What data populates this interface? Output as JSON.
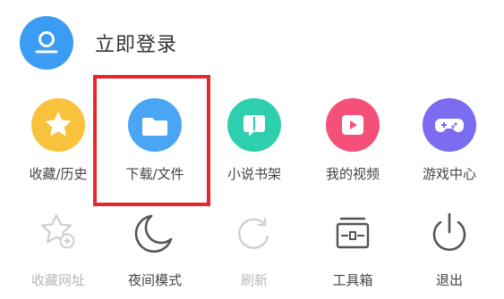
{
  "login": {
    "label": "立即登录",
    "avatar_icon": "user-avatar-icon",
    "avatar_color": "#3a9cf2"
  },
  "menu": {
    "row1": [
      {
        "label": "收藏/历史",
        "icon": "star-icon",
        "color": "#f9c23c"
      },
      {
        "label": "下载/文件",
        "icon": "folder-icon",
        "color": "#4aa6f5"
      },
      {
        "label": "小说书架",
        "icon": "book-icon",
        "color": "#2ecfae"
      },
      {
        "label": "我的视频",
        "icon": "play-icon",
        "color": "#f5507a"
      },
      {
        "label": "游戏中心",
        "icon": "gamepad-icon",
        "color": "#7b6cf0"
      }
    ],
    "row2": [
      {
        "label": "收藏网址",
        "icon": "star-add-icon",
        "disabled": true
      },
      {
        "label": "夜间模式",
        "icon": "moon-icon",
        "disabled": false
      },
      {
        "label": "刷新",
        "icon": "refresh-icon",
        "disabled": true
      },
      {
        "label": "工具箱",
        "icon": "toolbox-icon",
        "disabled": false
      },
      {
        "label": "退出",
        "icon": "power-icon",
        "disabled": false
      }
    ]
  },
  "highlight_color": "#e8262b"
}
